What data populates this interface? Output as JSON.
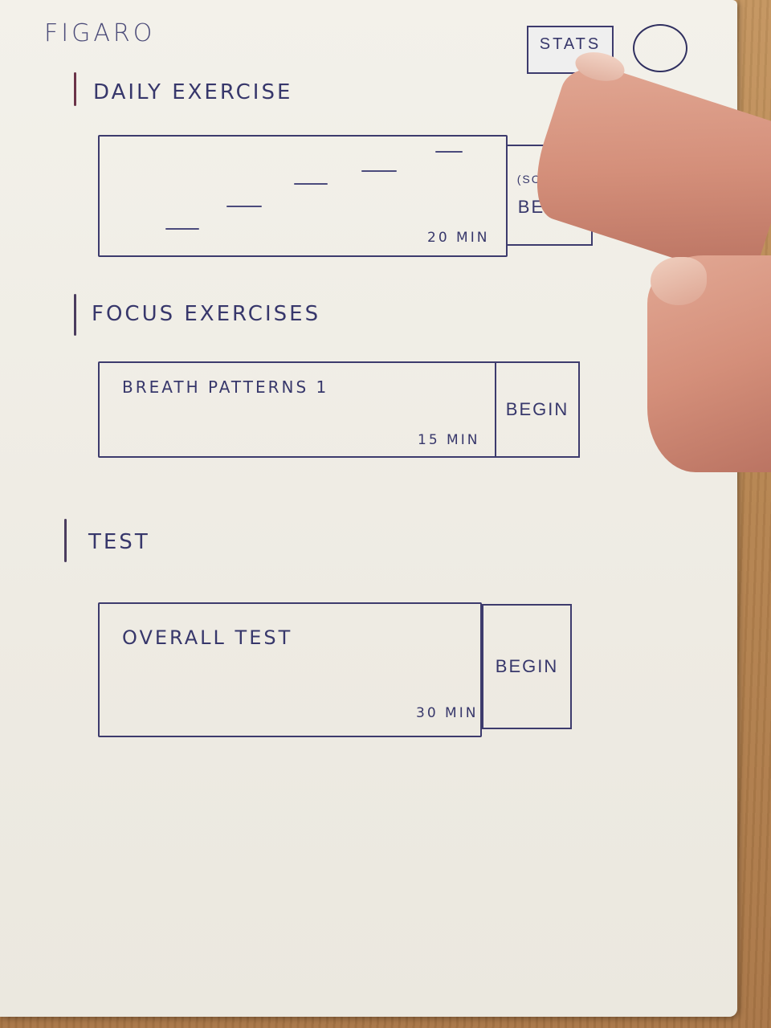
{
  "header": {
    "app_title": "Figaro",
    "stats_label": "Stats"
  },
  "sections": {
    "daily": {
      "title": "Daily Exercise",
      "duration": "20 min",
      "subtitle": "(Scales)",
      "begin_label": "Begin"
    },
    "focus": {
      "title": "Focus Exercises",
      "item_name": "Breath patterns 1",
      "duration": "15 min",
      "begin_label": "Begin"
    },
    "test": {
      "title": "Test",
      "item_name": "Overall test",
      "duration": "30 min",
      "begin_label": "Begin"
    }
  },
  "colors": {
    "ink": "#37376b",
    "paper": "#f1efe8",
    "desk": "#b98a5a"
  },
  "icons": {
    "profile": "avatar-circle-icon"
  }
}
